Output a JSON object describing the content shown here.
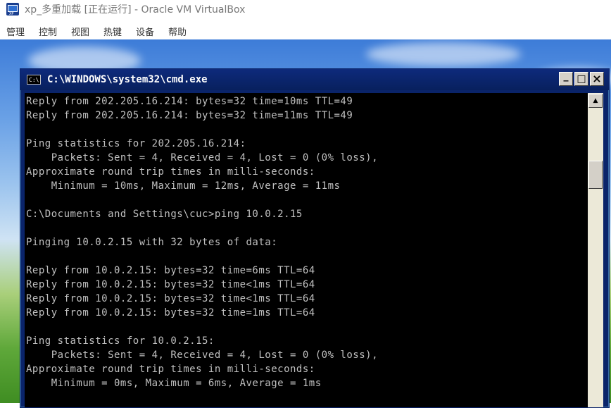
{
  "host": {
    "title": "xp_多重加载 [正在运行] - Oracle VM VirtualBox",
    "icon": "virtualbox-icon",
    "menu": [
      "管理",
      "控制",
      "视图",
      "热键",
      "设备",
      "帮助"
    ]
  },
  "cmd": {
    "title": "C:\\WINDOWS\\system32\\cmd.exe",
    "icon_label": "C:\\",
    "buttons": {
      "minimize": "_",
      "maximize": "□",
      "close": "×"
    },
    "lines": [
      "Reply from 202.205.16.214: bytes=32 time=10ms TTL=49",
      "Reply from 202.205.16.214: bytes=32 time=11ms TTL=49",
      "",
      "Ping statistics for 202.205.16.214:",
      "    Packets: Sent = 4, Received = 4, Lost = 0 (0% loss),",
      "Approximate round trip times in milli-seconds:",
      "    Minimum = 10ms, Maximum = 12ms, Average = 11ms",
      "",
      "C:\\Documents and Settings\\cuc>ping 10.0.2.15",
      "",
      "Pinging 10.0.2.15 with 32 bytes of data:",
      "",
      "Reply from 10.0.2.15: bytes=32 time=6ms TTL=64",
      "Reply from 10.0.2.15: bytes=32 time<1ms TTL=64",
      "Reply from 10.0.2.15: bytes=32 time<1ms TTL=64",
      "Reply from 10.0.2.15: bytes=32 time=1ms TTL=64",
      "",
      "Ping statistics for 10.0.2.15:",
      "    Packets: Sent = 4, Received = 4, Lost = 0 (0% loss),",
      "Approximate round trip times in milli-seconds:",
      "    Minimum = 0ms, Maximum = 6ms, Average = 1ms"
    ]
  },
  "colors": {
    "cmd_bg": "#000000",
    "cmd_text": "#c0c0c0",
    "titlebar": "#0a246a"
  }
}
